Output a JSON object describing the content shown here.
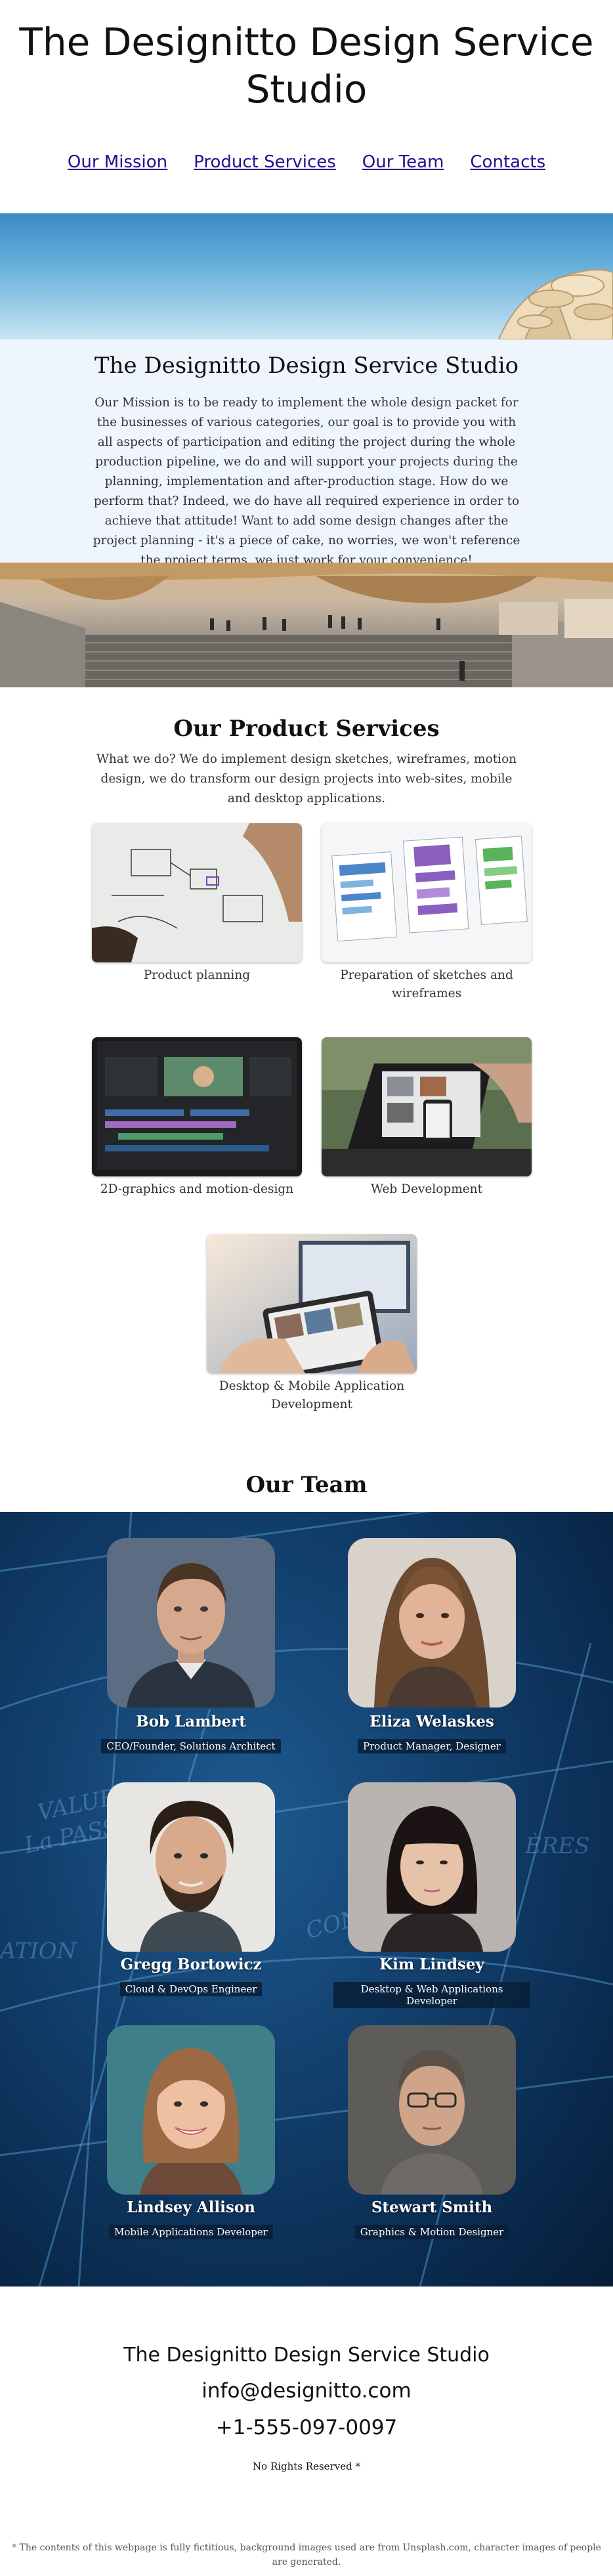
{
  "header": {
    "title": "The Designitto Design Service Studio",
    "nav": [
      "Our Mission",
      "Product Services",
      "Our Team",
      "Contacts"
    ]
  },
  "mission": {
    "title": "The Designitto Design Service Studio",
    "text": "Our Mission is to be ready to implement the whole design packet for the businesses of various categories, our goal is to provide you with all aspects of participation and editing the project during the whole production pipeline, we do and will support your projects during the planning, implementation and after-production stage. How do we perform that? Indeed, we do have all required experience in order to achieve that attitude! Want to add some design changes after the project planning - it's a piece of cake, no worries, we won't reference the project terms, we just work for your convenience!"
  },
  "services": {
    "title": "Our Product Services",
    "intro": "What we do? We do implement design sketches, wireframes, motion design, we do transform our design projects into web-sites, mobile and desktop applications.",
    "items": [
      "Product planning",
      "Preparation of sketches and wireframes",
      "2D-graphics and motion-design",
      "Web Development",
      "Desktop & Mobile Application Development"
    ]
  },
  "team": {
    "title": "Our Team",
    "members": [
      {
        "name": "Bob Lambert",
        "role": "CEO/Founder, Solutions Architect"
      },
      {
        "name": "Eliza Welaskes",
        "role": "Product Manager, Designer"
      },
      {
        "name": "Gregg Bortowicz",
        "role": "Cloud & DevOps Engineer"
      },
      {
        "name": "Kim Lindsey",
        "role": "Desktop & Web Applications Developer"
      },
      {
        "name": "Lindsey Allison",
        "role": "Mobile Applications Developer"
      },
      {
        "name": "Stewart Smith",
        "role": "Graphics & Motion Designer"
      }
    ]
  },
  "footer": {
    "name": "The Designitto Design Service Studio",
    "email": "info@designitto.com",
    "phone": "+1-555-097-0097",
    "rights": "No Rights Reserved *",
    "note": "* The contents of this webpage is fully fictitious, background images used are from Unsplash.com, character images of people are generated."
  },
  "colors": {
    "nav_link": "#2b0d8f",
    "mission_bg": "#eef5fc",
    "team_bg": "#0a2b4f"
  }
}
